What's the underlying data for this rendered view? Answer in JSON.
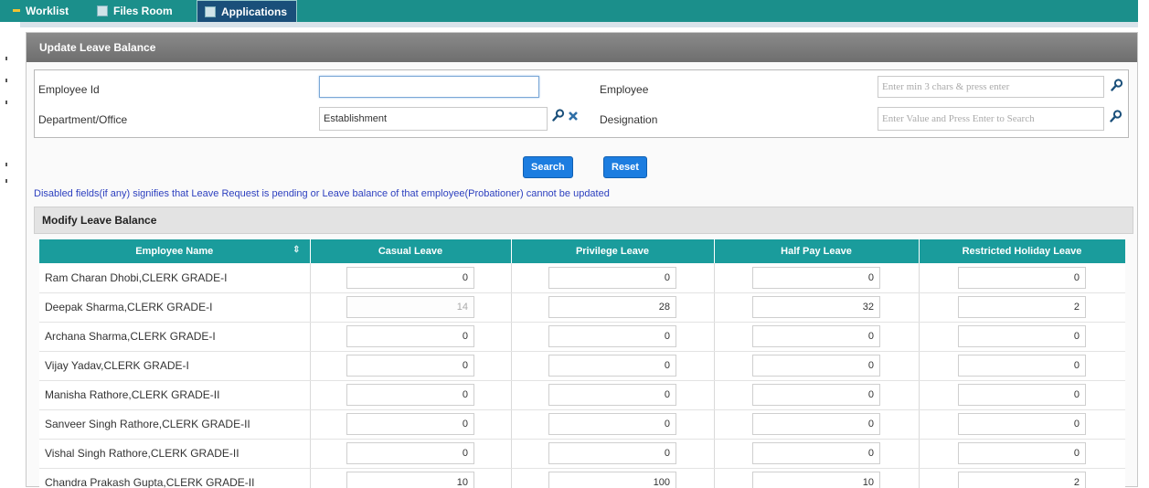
{
  "tabs": {
    "worklist": "Worklist",
    "files_room": "Files Room",
    "applications": "Applications"
  },
  "panel": {
    "title": "Update Leave Balance"
  },
  "filters": {
    "employee_id_label": "Employee Id",
    "employee_id_value": "",
    "employee_label": "Employee",
    "employee_placeholder": "Enter min 3 chars & press enter",
    "department_label": "Department/Office",
    "department_value": "Establishment",
    "designation_label": "Designation",
    "designation_placeholder": "Enter Value and Press Enter to Search"
  },
  "buttons": {
    "search": "Search",
    "reset": "Reset"
  },
  "notice": "Disabled fields(if any) signifies that Leave Request is pending or Leave balance of that employee(Probationer) cannot be updated",
  "modify": {
    "title": "Modify Leave Balance",
    "columns": [
      "Employee Name",
      "Casual Leave",
      "Privilege Leave",
      "Half Pay Leave",
      "Restricted Holiday Leave"
    ],
    "sort_icon": "sort-icon",
    "rows": [
      {
        "name": "Ram Charan Dhobi,CLERK GRADE-I",
        "cl": "0",
        "pl": "0",
        "hpl": "0",
        "rhl": "0",
        "cl_disabled": false
      },
      {
        "name": "Deepak Sharma,CLERK GRADE-I",
        "cl": "14",
        "pl": "28",
        "hpl": "32",
        "rhl": "2",
        "cl_disabled": true
      },
      {
        "name": "Archana Sharma,CLERK GRADE-I",
        "cl": "0",
        "pl": "0",
        "hpl": "0",
        "rhl": "0",
        "cl_disabled": false
      },
      {
        "name": "Vijay Yadav,CLERK GRADE-I",
        "cl": "0",
        "pl": "0",
        "hpl": "0",
        "rhl": "0",
        "cl_disabled": false
      },
      {
        "name": "Manisha Rathore,CLERK GRADE-II",
        "cl": "0",
        "pl": "0",
        "hpl": "0",
        "rhl": "0",
        "cl_disabled": false
      },
      {
        "name": "Sanveer Singh Rathore,CLERK GRADE-II",
        "cl": "0",
        "pl": "0",
        "hpl": "0",
        "rhl": "0",
        "cl_disabled": false
      },
      {
        "name": "Vishal Singh Rathore,CLERK GRADE-II",
        "cl": "0",
        "pl": "0",
        "hpl": "0",
        "rhl": "0",
        "cl_disabled": false
      },
      {
        "name": "Chandra Prakash Gupta,CLERK GRADE-II",
        "cl": "10",
        "pl": "100",
        "hpl": "10",
        "rhl": "2",
        "cl_disabled": false
      }
    ]
  },
  "colors": {
    "tab_bar": "#1b8f8b",
    "grid_header": "#1a9c9c",
    "button": "#1c7de0",
    "notice_text": "#2c3fbf"
  },
  "icons": {
    "lookup": "search-icon",
    "clear": "clear-icon"
  }
}
